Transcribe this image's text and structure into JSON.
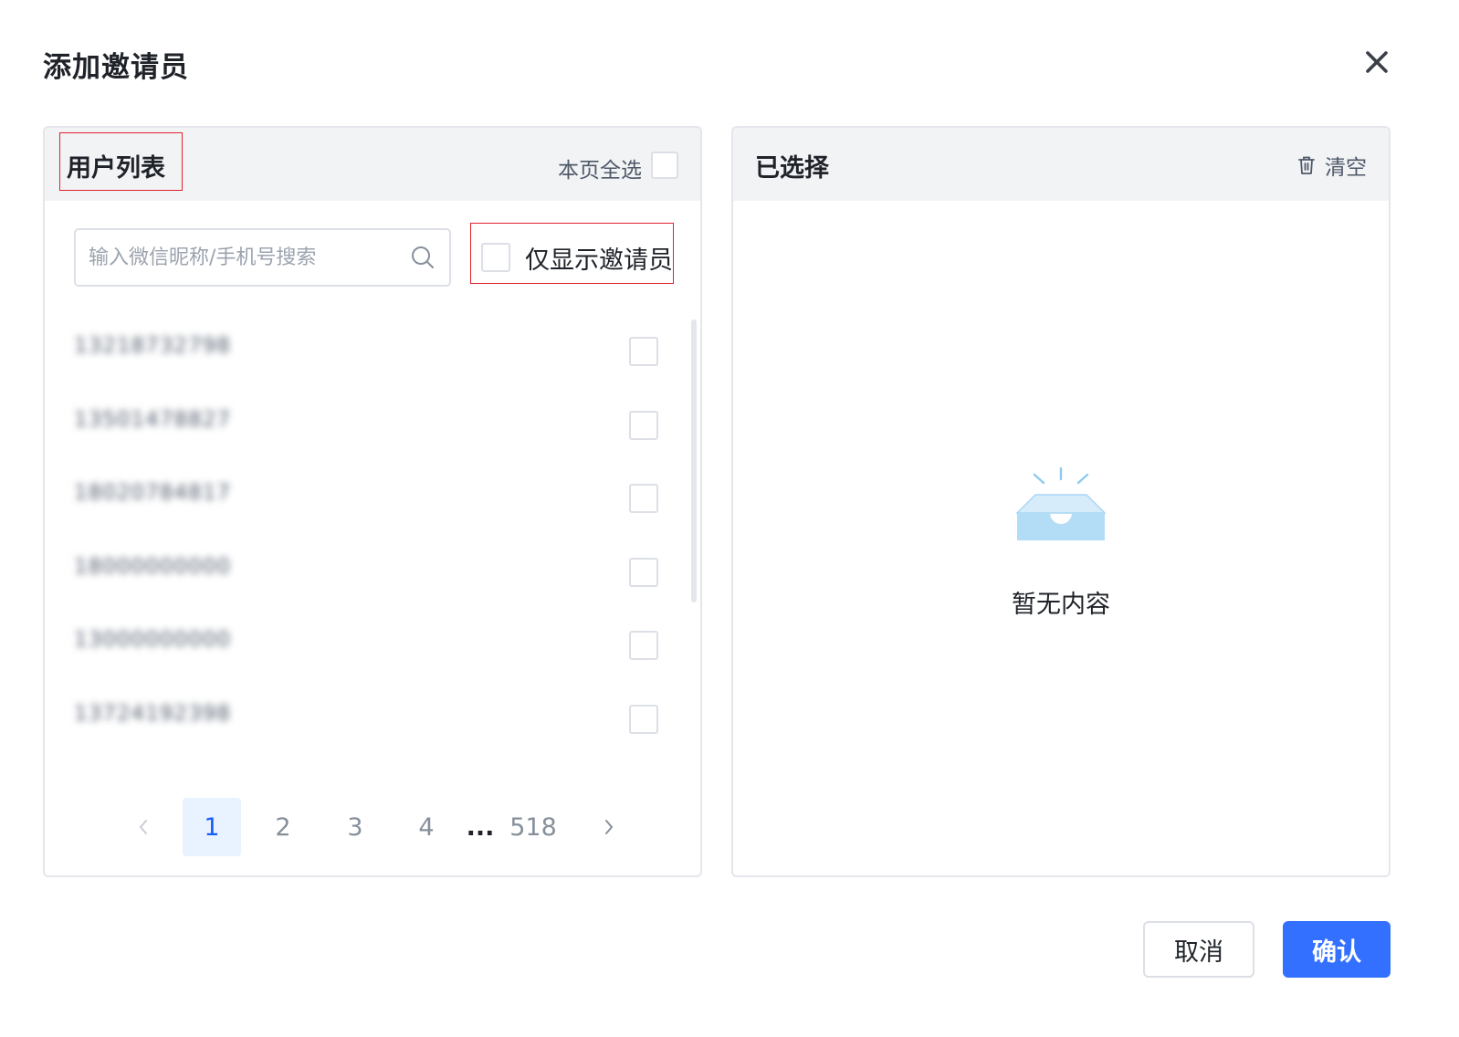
{
  "dialog": {
    "title": "添加邀请员"
  },
  "left_panel": {
    "title": "用户列表",
    "select_all_label": "本页全选",
    "search": {
      "placeholder": "输入微信昵称/手机号搜索",
      "value": ""
    },
    "invitee_only_label": "仅显示邀请员",
    "users": [
      {
        "phone": "13218732798"
      },
      {
        "phone": "13501478827"
      },
      {
        "phone": "18020784817"
      },
      {
        "phone": "18000000000"
      },
      {
        "phone": "13000000000"
      },
      {
        "phone": "13724192398"
      }
    ],
    "pagination": {
      "prev_icon": "chevron-left-icon",
      "pages": [
        "1",
        "2",
        "3",
        "4"
      ],
      "ellipsis": "...",
      "last_page": "518",
      "current_page": "1",
      "next_icon": "chevron-right-icon"
    }
  },
  "right_panel": {
    "title": "已选择",
    "clear_label": "清空",
    "clear_icon": "trash-icon",
    "empty_text": "暂无内容",
    "empty_icon": "empty-inbox-icon"
  },
  "footer": {
    "cancel_label": "取消",
    "confirm_label": "确认"
  },
  "colors": {
    "primary": "#3370ff",
    "active_page_bg": "#e8f3ff",
    "header_bg": "#f2f3f5",
    "highlight_box": "#e0212f",
    "empty_icon": "#b3dcf7"
  }
}
